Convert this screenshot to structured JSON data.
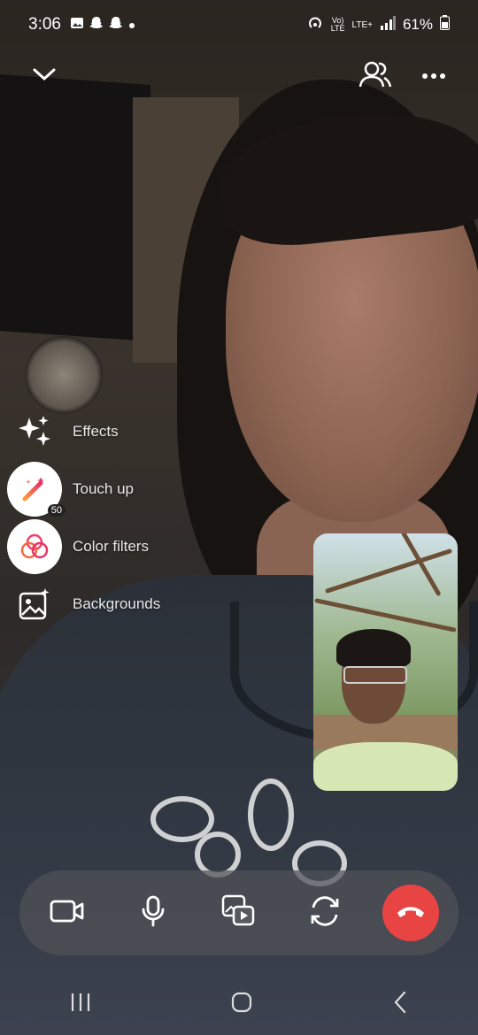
{
  "status_bar": {
    "time": "3:06",
    "battery": "61%",
    "network": "LTE+",
    "icons": [
      "gallery-icon",
      "snapchat-icon",
      "snapchat-icon",
      "dot-icon",
      "hotspot-icon",
      "volte-icon",
      "signal-icon",
      "battery-icon"
    ]
  },
  "top": {
    "icons": [
      "chevron-down-icon",
      "participants-icon",
      "more-icon"
    ]
  },
  "effects_menu": [
    {
      "label": "Effects",
      "icon": "sparkle-icon"
    },
    {
      "label": "Touch up",
      "icon": "magic-wand-icon",
      "badge": "50"
    },
    {
      "label": "Color filters",
      "icon": "color-filter-icon"
    },
    {
      "label": "Backgrounds",
      "icon": "background-image-icon"
    }
  ],
  "call_controls": {
    "icons": [
      "video-camera-icon",
      "microphone-icon",
      "share-media-icon",
      "switch-camera-icon",
      "end-call-icon"
    ],
    "end_color": "#e94444"
  },
  "nav_bar": {
    "icons": [
      "recents-icon",
      "home-icon",
      "back-icon"
    ]
  }
}
